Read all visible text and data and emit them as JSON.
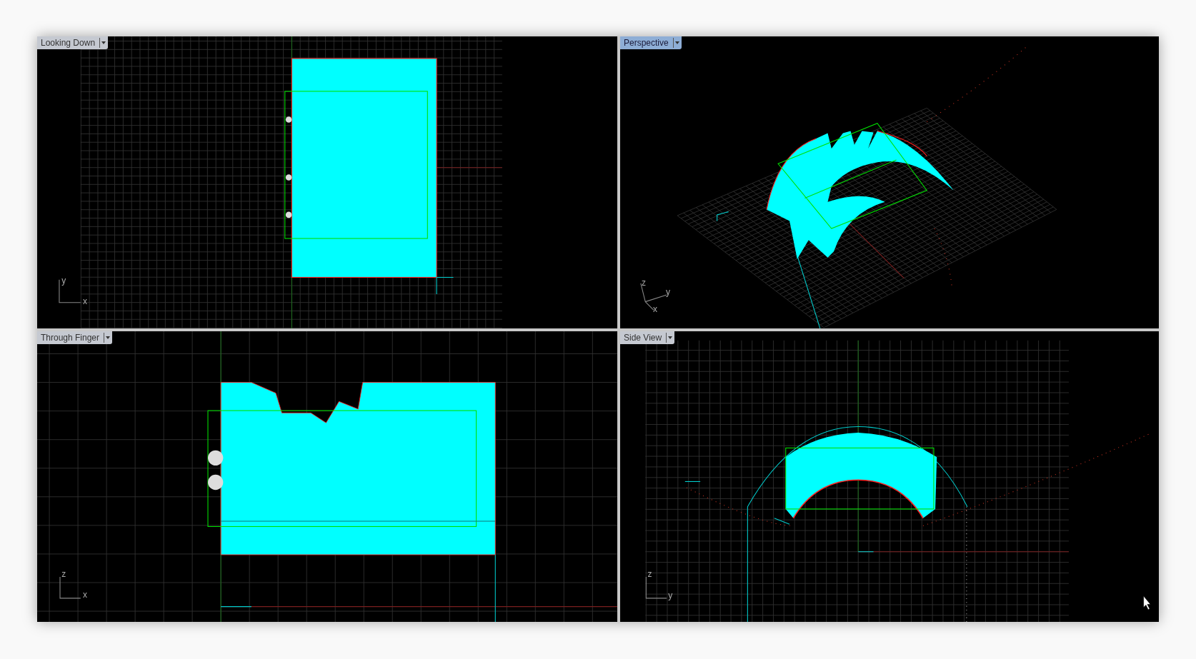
{
  "viewports": [
    {
      "title": "Looking Down",
      "selected": false,
      "kind": "top",
      "axes": [
        {
          "label": "y"
        },
        {
          "label": "x"
        }
      ]
    },
    {
      "title": "Perspective",
      "selected": true,
      "kind": "perspective",
      "axes": [
        {
          "label": "z"
        },
        {
          "label": "y"
        },
        {
          "label": "x"
        }
      ]
    },
    {
      "title": "Through Finger",
      "selected": false,
      "kind": "front",
      "axes": [
        {
          "label": "z"
        },
        {
          "label": "x"
        }
      ]
    },
    {
      "title": "Side View",
      "selected": false,
      "kind": "side",
      "axes": [
        {
          "label": "z"
        },
        {
          "label": "y"
        }
      ]
    }
  ]
}
